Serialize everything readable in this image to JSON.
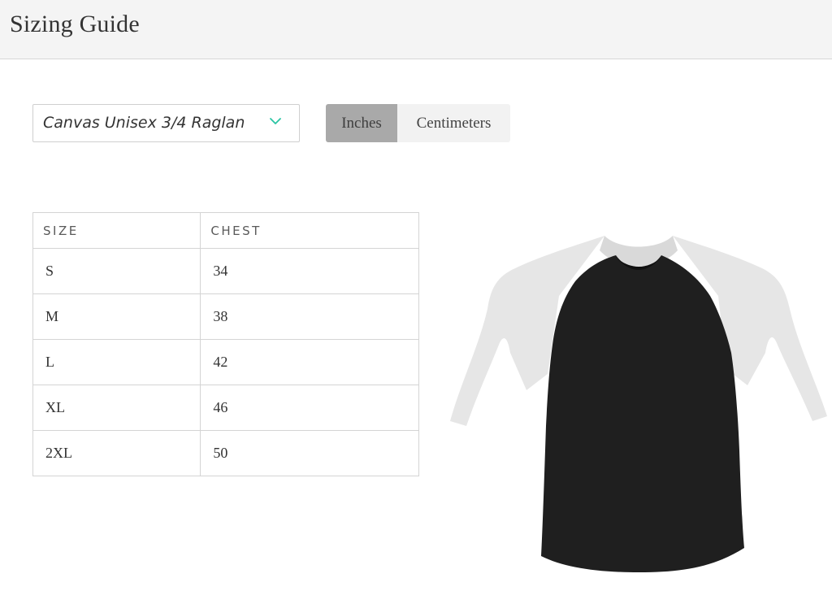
{
  "header": {
    "title": "Sizing Guide"
  },
  "product_select": {
    "value": "Canvas Unisex 3/4 Raglan",
    "accent_color": "#2bc4a4"
  },
  "unit_toggle": {
    "options": [
      "Inches",
      "Centimeters"
    ],
    "selected": "Inches"
  },
  "size_table": {
    "headers": [
      "SIZE",
      "CHEST"
    ],
    "rows": [
      {
        "size": "S",
        "chest": "34"
      },
      {
        "size": "M",
        "chest": "38"
      },
      {
        "size": "L",
        "chest": "42"
      },
      {
        "size": "XL",
        "chest": "46"
      },
      {
        "size": "2XL",
        "chest": "50"
      }
    ]
  },
  "product_image": {
    "body_color": "#1f1f1f",
    "sleeve_color": "#e6e6e6"
  }
}
